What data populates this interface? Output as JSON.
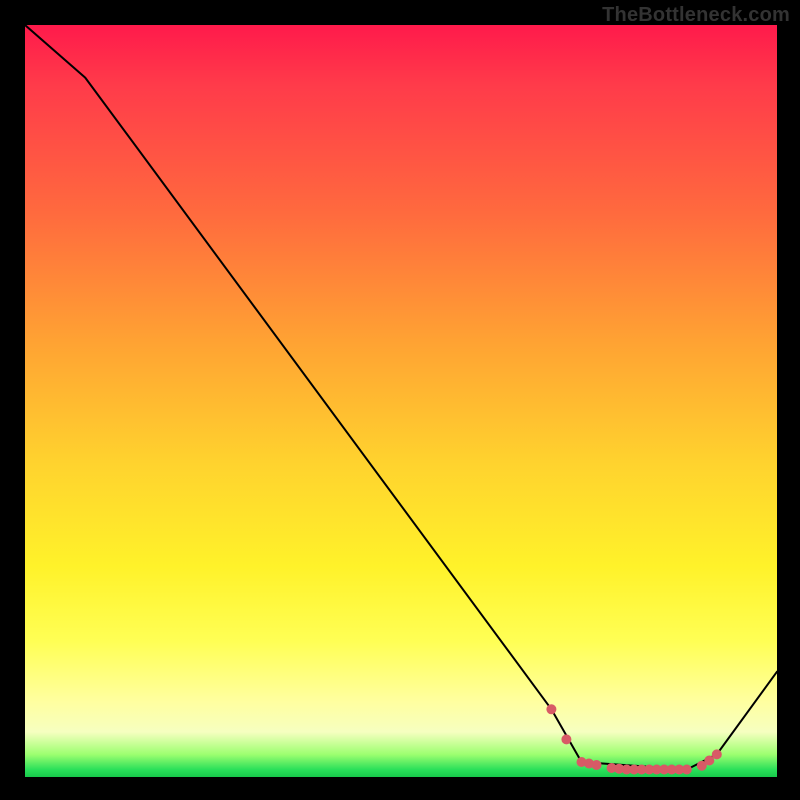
{
  "watermark": "TheBottleneck.com",
  "chart_data": {
    "type": "line",
    "title": "",
    "xlabel": "",
    "ylabel": "",
    "xlim": [
      0,
      100
    ],
    "ylim": [
      0,
      100
    ],
    "grid": false,
    "series": [
      {
        "name": "curve",
        "x": [
          0,
          8,
          70,
          74,
          88,
          92,
          100
        ],
        "y": [
          100,
          93,
          9,
          2,
          1,
          3,
          14
        ]
      }
    ],
    "markers": {
      "name": "floor-dots",
      "color": "#d85a66",
      "x": [
        70,
        72,
        74,
        75,
        76,
        78,
        79,
        80,
        81,
        82,
        83,
        84,
        85,
        86,
        87,
        88,
        90,
        91,
        92
      ],
      "y": [
        9,
        5,
        2,
        1.8,
        1.6,
        1.2,
        1.1,
        1.0,
        1.0,
        1.0,
        1.0,
        1.0,
        1.0,
        1.0,
        1.0,
        1.0,
        1.5,
        2.2,
        3
      ]
    },
    "background_gradient": {
      "direction": "vertical",
      "stops": [
        {
          "pos": 0.0,
          "color": "#ff1a4b"
        },
        {
          "pos": 0.25,
          "color": "#ff6a3e"
        },
        {
          "pos": 0.58,
          "color": "#ffd22e"
        },
        {
          "pos": 0.82,
          "color": "#ffff55"
        },
        {
          "pos": 0.97,
          "color": "#9dff70"
        },
        {
          "pos": 1.0,
          "color": "#17c94b"
        }
      ]
    }
  }
}
